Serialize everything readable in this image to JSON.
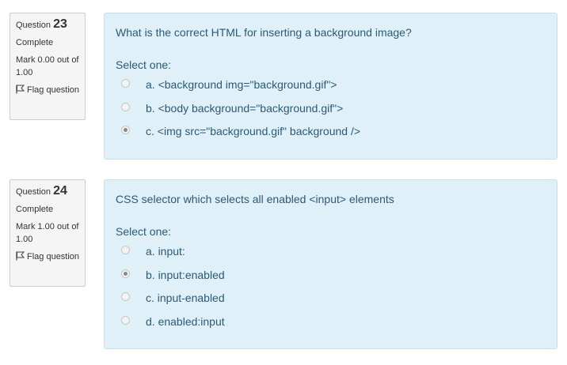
{
  "questions": [
    {
      "label": "Question",
      "number": "23",
      "state": "Complete",
      "grade": "Mark 0.00 out of 1.00",
      "flag_label": "Flag question",
      "text": "What is the correct HTML for inserting a background image?",
      "prompt": "Select one:",
      "answers": [
        {
          "label": "a. <background img=\"background.gif\">",
          "checked": false
        },
        {
          "label": "b. <body background=\"background.gif\">",
          "checked": false
        },
        {
          "label": "c. <img src=\"background.gif\" background />",
          "checked": true
        }
      ]
    },
    {
      "label": "Question",
      "number": "24",
      "state": "Complete",
      "grade": "Mark 1.00 out of 1.00",
      "flag_label": "Flag question",
      "text": "CSS selector which selects all enabled <input> elements",
      "prompt": "Select one:",
      "answers": [
        {
          "label": "a. input:",
          "checked": false
        },
        {
          "label": "b. input:enabled",
          "checked": true
        },
        {
          "label": "c. input-enabled",
          "checked": false
        },
        {
          "label": "d. enabled:input",
          "checked": false
        }
      ]
    }
  ],
  "colors": {
    "info_bg": "#f5f5f5",
    "content_bg": "#dff0f8",
    "content_text": "#2b5a75"
  },
  "icons": {
    "flag": "flag-icon"
  }
}
